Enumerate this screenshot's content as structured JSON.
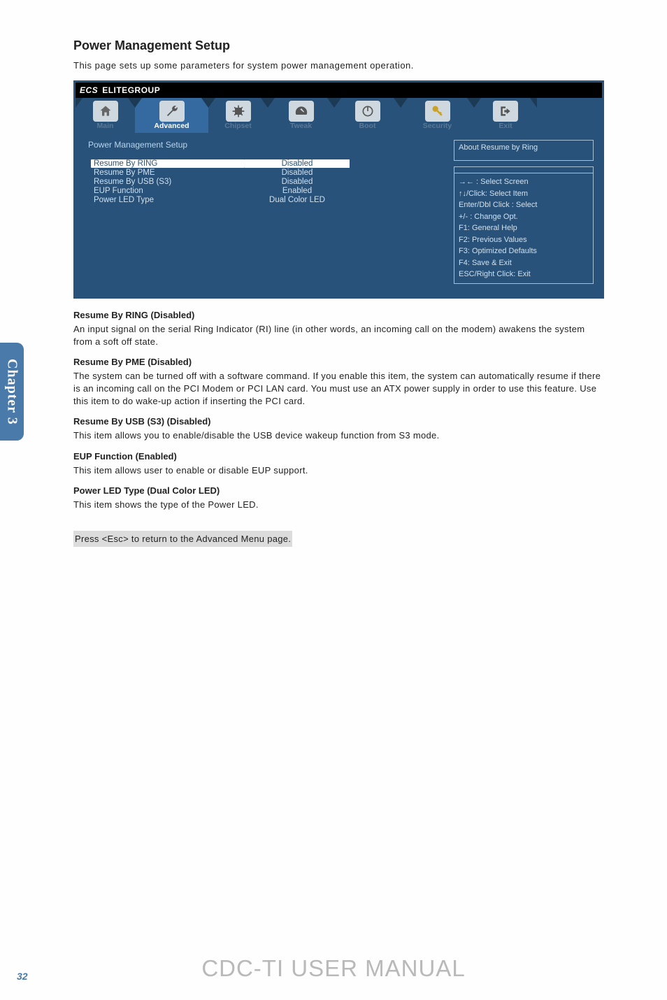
{
  "page": {
    "title": "Power Management Setup",
    "intro": "This page sets up some parameters for system power management operation."
  },
  "bios": {
    "brand_a": "ECS",
    "brand_b": "ELITEGROUP",
    "tabs": {
      "main": "Main",
      "advanced": "Advanced",
      "chipset": "Chipset",
      "tweak": "Tweak",
      "boot": "Boot",
      "security": "Security",
      "exit": "Exit"
    },
    "section": "Power Management Setup",
    "settings": [
      {
        "label": "Resume By RING",
        "value": "Disabled"
      },
      {
        "label": "Resume By  PME",
        "value": "Disabled"
      },
      {
        "label": "Resume By USB (S3)",
        "value": "Disabled"
      },
      {
        "label": "EUP Function",
        "value": "Enabled"
      },
      {
        "label": "Power LED Type",
        "value": "Dual Color LED"
      }
    ],
    "help_title": "About  Resume by Ring",
    "hints": [
      "→←   : Select Screen",
      "↑↓/Click: Select Item",
      "Enter/Dbl Click : Select",
      "+/- : Change Opt.",
      "F1: General Help",
      "F2: Previous Values",
      "F3: Optimized Defaults",
      "F4: Save & Exit",
      "ESC/Right Click: Exit"
    ]
  },
  "sections": {
    "s1": {
      "h": "Resume By RING (Disabled)",
      "p": "An input signal on the serial Ring Indicator (RI) line (in other words, an incoming call on the modem) awakens the system from a soft off state."
    },
    "s2": {
      "h": "Resume By PME (Disabled)",
      "p": "The system can be turned off with a software command. If you enable this item, the system can automatically resume if there is an incoming call on the PCI Modem or PCI LAN card. You must use an ATX power supply in order to use this feature. Use this item to do wake-up action if inserting the PCI card."
    },
    "s3": {
      "h": "Resume By USB (S3) (Disabled)",
      "p": "This item allows you to enable/disable the USB device wakeup function from S3 mode."
    },
    "s4": {
      "h": "EUP Function (Enabled)",
      "p": "This item allows user to enable or disable EUP support."
    },
    "s5": {
      "h": "Power LED Type (Dual Color LED)",
      "p": "This item shows the type of the Power LED."
    }
  },
  "tail": "Press <Esc> to return to the Advanced Menu page.",
  "sidebar": "Chapter 3",
  "footer": {
    "manual": "CDC-TI USER MANUAL",
    "page": "32"
  }
}
